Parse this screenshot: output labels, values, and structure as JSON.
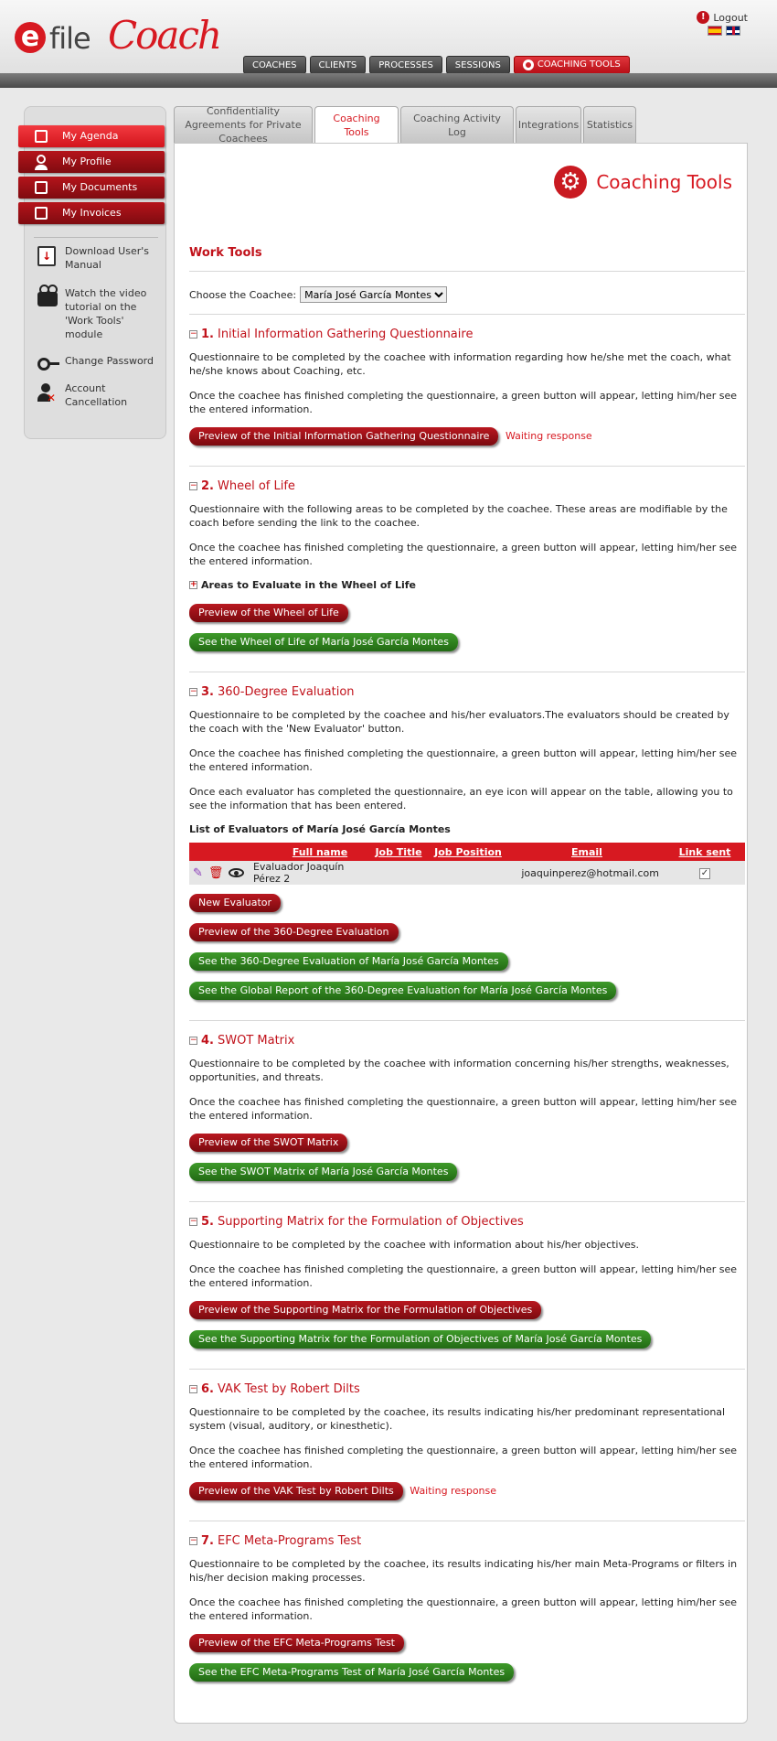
{
  "header": {
    "logo_e": "e",
    "logo_file": "file",
    "logo_coach": "Coach",
    "logout_label": "Logout",
    "nav": [
      "COACHES",
      "CLIENTS",
      "PROCESSES",
      "SESSIONS"
    ],
    "nav_active": "COACHING TOOLS"
  },
  "sidebar": {
    "menu": [
      "My Agenda",
      "My Profile",
      "My Documents",
      "My Invoices"
    ],
    "links": [
      "Download User's Manual",
      "Watch the video tutorial on the 'Work Tools' module",
      "Change Password",
      "Account Cancellation"
    ]
  },
  "tabs": [
    "Confidentiality Agreements for Private Coachees",
    "Coaching Tools",
    "Coaching Activity Log",
    "Integrations",
    "Statistics"
  ],
  "page": {
    "title": "Coaching Tools",
    "work_tools": "Work Tools",
    "choose_label": "Choose the Coachee:",
    "coachee": "María José García Montes"
  },
  "common": {
    "finished": "Once the coachee has finished completing the questionnaire, a green button will appear, letting him/her see the entered information.",
    "waiting": "Waiting response"
  },
  "sections": {
    "s1": {
      "num": "1.",
      "title": "Initial Information Gathering Questionnaire",
      "desc": "Questionnaire to be completed by the coachee with information regarding how he/she met the coach, what he/she knows about Coaching, etc.",
      "preview": "Preview of the Initial Information Gathering Questionnaire"
    },
    "s2": {
      "num": "2.",
      "title": "Wheel of Life",
      "desc": "Questionnaire with the following areas to be completed by the coachee. These areas are modifiable by the coach before sending the link to the coachee.",
      "areas": "Areas to Evaluate in the Wheel of Life",
      "preview": "Preview of the Wheel of Life",
      "see": "See the Wheel of Life of María José García Montes"
    },
    "s3": {
      "num": "3.",
      "title": "360-Degree Evaluation",
      "desc": "Questionnaire to be completed by the coachee and his/her evaluators.The evaluators should be created by the coach with the 'New Evaluator' button.",
      "eye_note": "Once each evaluator has completed the questionnaire, an eye icon will appear on the table, allowing you to see the information that has been entered.",
      "list_title": "List of Evaluators of María José García Montes",
      "columns": [
        "Full name",
        "Job Title",
        "Job Position",
        "Email",
        "Link sent"
      ],
      "row": {
        "name": "Evaluador Joaquín Pérez 2",
        "job_title": "",
        "job_position": "",
        "email": "joaquinperez@hotmail.com",
        "link_sent": "✓"
      },
      "new_evaluator": "New Evaluator",
      "preview": "Preview of the 360-Degree Evaluation",
      "see": "See the 360-Degree Evaluation of María José García Montes",
      "global": "See the Global Report of the 360-Degree Evaluation for María José García Montes"
    },
    "s4": {
      "num": "4.",
      "title": "SWOT Matrix",
      "desc": "Questionnaire to be completed by the coachee with information concerning his/her strengths, weaknesses, opportunities, and threats.",
      "preview": "Preview of the SWOT Matrix",
      "see": "See the SWOT Matrix of María José García Montes"
    },
    "s5": {
      "num": "5.",
      "title": "Supporting Matrix for the Formulation of Objectives",
      "desc": "Questionnaire to be completed by the coachee with information about his/her objectives.",
      "preview": "Preview of the Supporting Matrix for the Formulation of Objectives",
      "see": "See the Supporting Matrix for the Formulation of Objectives of María José García Montes"
    },
    "s6": {
      "num": "6.",
      "title": "VAK Test by Robert Dilts",
      "desc": "Questionnaire to be completed by the coachee, its results indicating his/her predominant representational system (visual, auditory, or kinesthetic).",
      "preview": "Preview of the VAK Test by Robert Dilts"
    },
    "s7": {
      "num": "7.",
      "title": "EFC Meta-Programs Test",
      "desc": "Questionnaire to be completed by the coachee, its results indicating his/her main Meta-Programs or filters in his/her decision making processes.",
      "preview": "Preview of the EFC Meta-Programs Test",
      "see": "See the EFC Meta-Programs Test of María José García Montes"
    }
  },
  "colors": {
    "brand_red": "#d71921",
    "button_red": "#9a1017",
    "button_green": "#2f7f1f"
  }
}
